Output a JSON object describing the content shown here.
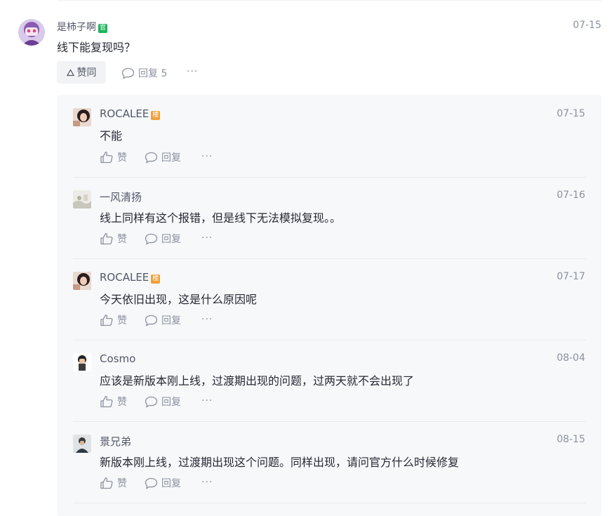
{
  "main_comment": {
    "username": "是柿子啊",
    "badge": "官",
    "time": "07-15",
    "content": "线下能复现吗？",
    "like_label": "赞同",
    "reply_label": "回复 5",
    "more": "···"
  },
  "replies": [
    {
      "username": "ROCALEE",
      "badge": "楼",
      "time": "07-15",
      "content": "不能",
      "like_label": "赞",
      "reply_label": "回复",
      "more": "···"
    },
    {
      "username": "一风清扬",
      "badge": "",
      "time": "07-16",
      "content": "线上同样有这个报错，但是线下无法模拟复现。。",
      "like_label": "赞",
      "reply_label": "回复",
      "more": "···"
    },
    {
      "username": "ROCALEE",
      "badge": "楼",
      "time": "07-17",
      "content": "今天依旧出现，这是什么原因呢",
      "like_label": "赞",
      "reply_label": "回复",
      "more": "···"
    },
    {
      "username": "Cosmo",
      "badge": "",
      "time": "08-04",
      "content": "应该是新版本刚上线，过渡期出现的问题，过两天就不会出现了",
      "like_label": "赞",
      "reply_label": "回复",
      "more": "···"
    },
    {
      "username": "景兄弟",
      "badge": "",
      "time": "08-15",
      "content": "新版本刚上线，过渡期出现这个问题。同样出现，请问官方什么时候修复",
      "like_label": "赞",
      "reply_label": "回复",
      "more": "···"
    }
  ],
  "colors": {
    "text_primary": "#252933",
    "text_secondary": "#515767",
    "text_muted": "#8a919f",
    "official_badge": "#1cb55b",
    "author_badge": "#f0a03c",
    "panel_bg": "#f7f8fa"
  }
}
